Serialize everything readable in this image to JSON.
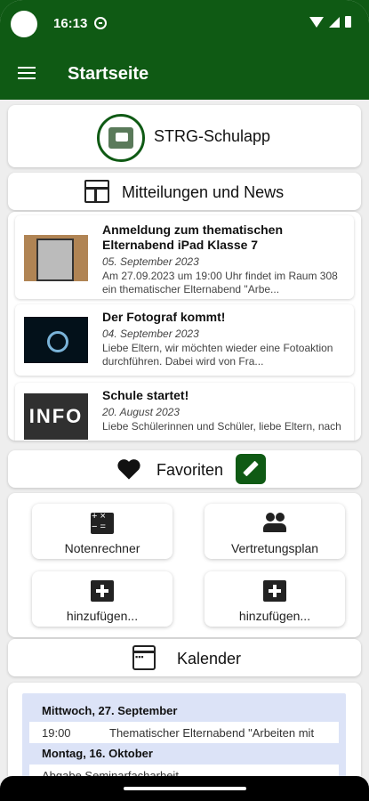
{
  "status": {
    "time": "16:13"
  },
  "appbar": {
    "title": "Startseite"
  },
  "header": {
    "title": "STRG-Schulapp"
  },
  "news": {
    "title": "Mitteilungen und News",
    "items": [
      {
        "title": "Anmeldung zum thematischen Elternabend iPad Klasse 7",
        "date": "05. September 2023",
        "text": "Am 27.09.2023 um 19:00 Uhr findet im Raum 308 ein thematischer Elternabend \"Arbe..."
      },
      {
        "title": "Der Fotograf kommt!",
        "date": "04. September 2023",
        "text": "Liebe Eltern, wir möchten wieder eine Fotoaktion durchführen. Dabei wird von Fra..."
      },
      {
        "title": "Schule startet!",
        "date": "20. August 2023",
        "text": "Liebe Schülerinnen und Schüler, liebe Eltern, nach",
        "thumb_text": "INFO"
      }
    ]
  },
  "favorites": {
    "title": "Favoriten",
    "tiles": [
      {
        "label": "Notenrechner",
        "icon": "calculator-icon"
      },
      {
        "label": "Vertretungsplan",
        "icon": "group-icon"
      },
      {
        "label": "hinzufügen...",
        "icon": "plus-icon"
      },
      {
        "label": "hinzufügen...",
        "icon": "plus-icon"
      }
    ]
  },
  "calendar": {
    "title": "Kalender",
    "days": [
      {
        "date": "Mittwoch, 27. September",
        "events": [
          {
            "time": "19:00",
            "text": "Thematischer Elternabend \"Arbeiten mit"
          }
        ]
      },
      {
        "date": "Montag, 16. Oktober",
        "events": [
          {
            "time": "",
            "text": "Abgabe Seminarfacharbeit"
          }
        ]
      }
    ]
  },
  "colors": {
    "primary": "#0f5a14",
    "background": "#eeeeee",
    "calendar_bg": "#dce3f7"
  }
}
